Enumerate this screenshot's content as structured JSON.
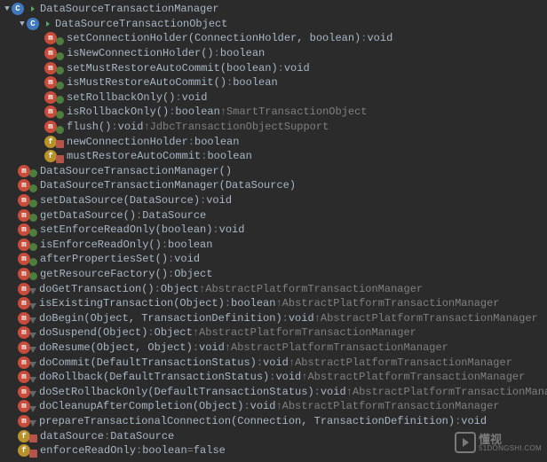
{
  "root": {
    "label": "DataSourceTransactionManager",
    "icon": "class",
    "expander": "▼",
    "hasRun": true
  },
  "inner": {
    "label": "DataSourceTransactionObject",
    "icon": "class",
    "expander": "▼",
    "hasRun": true
  },
  "innerMembers": [
    {
      "icon": "method",
      "vis": "pub",
      "sig": "setConnectionHolder(ConnectionHolder, boolean)",
      "ret": "void"
    },
    {
      "icon": "method",
      "vis": "pub",
      "sig": "isNewConnectionHolder()",
      "ret": "boolean"
    },
    {
      "icon": "method",
      "vis": "pub",
      "sig": "setMustRestoreAutoCommit(boolean)",
      "ret": "void"
    },
    {
      "icon": "method",
      "vis": "pub",
      "sig": "isMustRestoreAutoCommit()",
      "ret": "boolean"
    },
    {
      "icon": "method",
      "vis": "pub",
      "sig": "setRollbackOnly()",
      "ret": "void"
    },
    {
      "icon": "method",
      "vis": "pub",
      "sig": "isRollbackOnly()",
      "ret": "boolean",
      "overrides": "SmartTransactionObject"
    },
    {
      "icon": "method",
      "vis": "pub",
      "sig": "flush()",
      "ret": "void",
      "overrides": "JdbcTransactionObjectSupport"
    },
    {
      "icon": "field",
      "vis": "pri",
      "sig": "newConnectionHolder",
      "ret": "boolean"
    },
    {
      "icon": "field",
      "vis": "pri",
      "sig": "mustRestoreAutoCommit",
      "ret": "boolean"
    }
  ],
  "members": [
    {
      "icon": "method",
      "vis": "pub",
      "sig": "DataSourceTransactionManager()"
    },
    {
      "icon": "method",
      "vis": "pub",
      "sig": "DataSourceTransactionManager(DataSource)"
    },
    {
      "icon": "method",
      "vis": "pub",
      "sig": "setDataSource(DataSource)",
      "ret": "void"
    },
    {
      "icon": "method",
      "vis": "pub",
      "sig": "getDataSource()",
      "ret": "DataSource"
    },
    {
      "icon": "method",
      "vis": "pub",
      "sig": "setEnforceReadOnly(boolean)",
      "ret": "void"
    },
    {
      "icon": "method",
      "vis": "pub",
      "sig": "isEnforceReadOnly()",
      "ret": "boolean"
    },
    {
      "icon": "method",
      "vis": "pub",
      "sig": "afterPropertiesSet()",
      "ret": "void"
    },
    {
      "icon": "method",
      "vis": "pub",
      "sig": "getResourceFactory()",
      "ret": "Object"
    },
    {
      "icon": "method",
      "vis": "impl",
      "sig": "doGetTransaction()",
      "ret": "Object",
      "overrides": "AbstractPlatformTransactionManager"
    },
    {
      "icon": "method",
      "vis": "impl",
      "sig": "isExistingTransaction(Object)",
      "ret": "boolean",
      "overrides": "AbstractPlatformTransactionManager"
    },
    {
      "icon": "method",
      "vis": "impl",
      "sig": "doBegin(Object, TransactionDefinition)",
      "ret": "void",
      "overrides": "AbstractPlatformTransactionManager"
    },
    {
      "icon": "method",
      "vis": "impl",
      "sig": "doSuspend(Object)",
      "ret": "Object",
      "overrides": "AbstractPlatformTransactionManager"
    },
    {
      "icon": "method",
      "vis": "impl",
      "sig": "doResume(Object, Object)",
      "ret": "void",
      "overrides": "AbstractPlatformTransactionManager"
    },
    {
      "icon": "method",
      "vis": "impl",
      "sig": "doCommit(DefaultTransactionStatus)",
      "ret": "void",
      "overrides": "AbstractPlatformTransactionManager"
    },
    {
      "icon": "method",
      "vis": "impl",
      "sig": "doRollback(DefaultTransactionStatus)",
      "ret": "void",
      "overrides": "AbstractPlatformTransactionManager"
    },
    {
      "icon": "method",
      "vis": "impl",
      "sig": "doSetRollbackOnly(DefaultTransactionStatus)",
      "ret": "void",
      "overrides": "AbstractPlatformTransactionManager"
    },
    {
      "icon": "method",
      "vis": "impl",
      "sig": "doCleanupAfterCompletion(Object)",
      "ret": "void",
      "overrides": "AbstractPlatformTransactionManager"
    },
    {
      "icon": "method",
      "vis": "impl",
      "sig": "prepareTransactionalConnection(Connection, TransactionDefinition)",
      "ret": "void"
    },
    {
      "icon": "field",
      "vis": "pri",
      "sig": "dataSource",
      "ret": "DataSource"
    },
    {
      "icon": "field",
      "vis": "pri",
      "sig": "enforceReadOnly",
      "ret": "boolean",
      "init": "false"
    }
  ],
  "watermark": {
    "brand": "懂视",
    "site": "51DONGSHI.COM"
  }
}
